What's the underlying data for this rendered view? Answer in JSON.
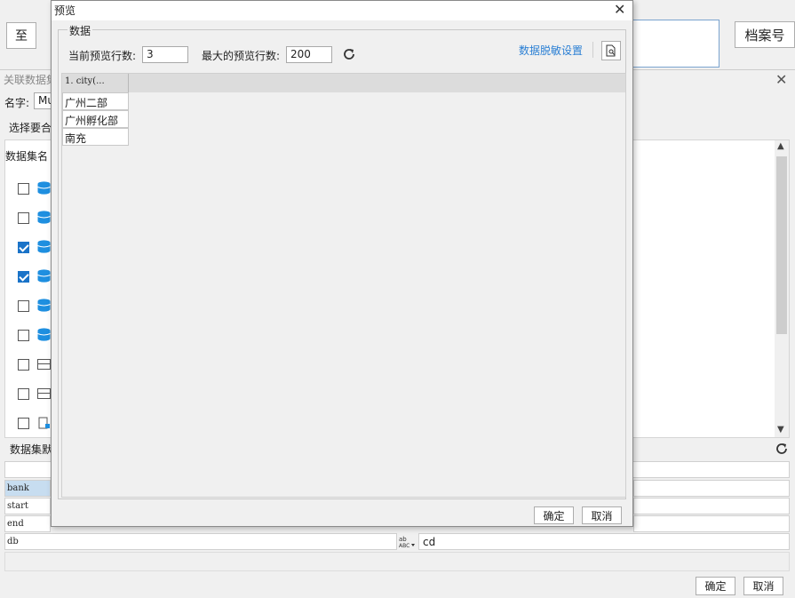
{
  "background": {
    "toolbar": {
      "zhi_label": "至",
      "archive_label": "档案号"
    },
    "window_title": "关联数据集",
    "name_label": "名字:",
    "name_value": "Mu",
    "select_label": "选择要合",
    "dataset_list_header": "数据集名",
    "dataset_items": [
      {
        "icon": "database-icon",
        "checked": false
      },
      {
        "icon": "database-icon",
        "checked": false
      },
      {
        "icon": "database-icon",
        "checked": true
      },
      {
        "icon": "database-icon",
        "checked": true
      },
      {
        "icon": "database-icon",
        "checked": false
      },
      {
        "icon": "database-icon",
        "checked": false
      },
      {
        "icon": "table-icon",
        "checked": false
      },
      {
        "icon": "table-icon",
        "checked": false
      },
      {
        "icon": "file-icon",
        "checked": false
      }
    ],
    "params_header": "数据集默",
    "params": [
      {
        "name": "bank",
        "value": ""
      },
      {
        "name": "start",
        "value": ""
      },
      {
        "name": "end",
        "value": ""
      },
      {
        "name": "db",
        "value": "cd"
      }
    ],
    "ok_label": "确定",
    "cancel_label": "取消"
  },
  "dialog": {
    "title": "预览",
    "group_label": "数据",
    "current_rows_label": "当前预览行数:",
    "current_rows_value": "3",
    "max_rows_label": "最大的预览行数:",
    "max_rows_value": "200",
    "desensitize_link": "数据脱敏设置",
    "column_header": "1. city(...",
    "rows": [
      "广州二部",
      "广州孵化部",
      "南充"
    ],
    "ok_label": "确定",
    "cancel_label": "取消"
  },
  "colors": {
    "accent": "#1a73c8",
    "link": "#2a7fd4",
    "db_icon": "#1e8fe0"
  }
}
